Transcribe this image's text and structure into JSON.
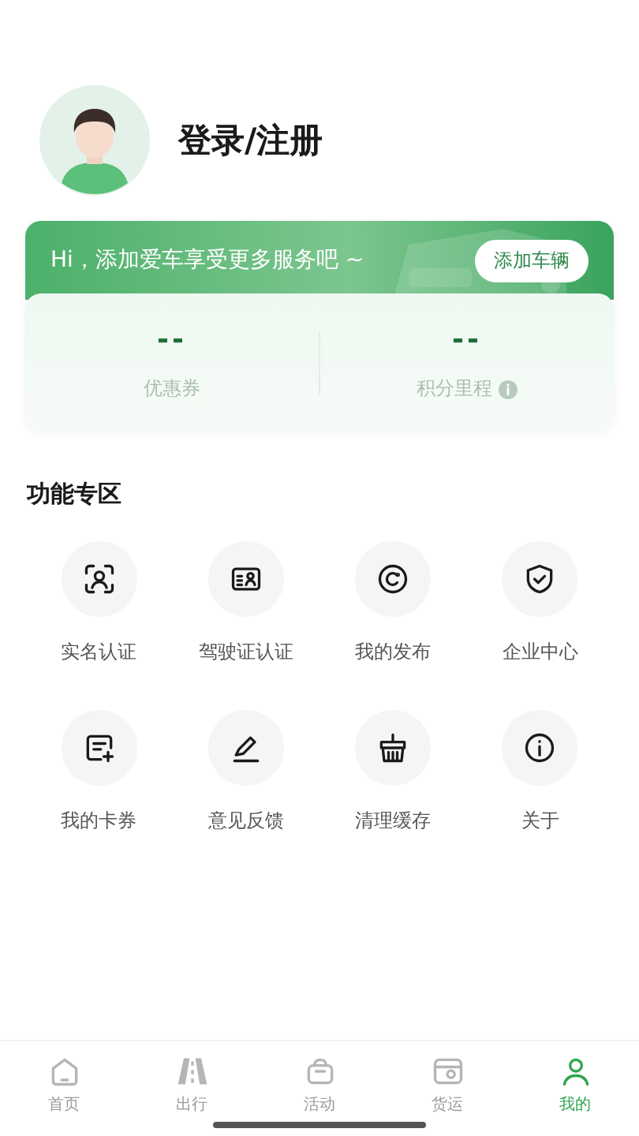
{
  "profile": {
    "login_label": "登录/注册"
  },
  "vehicle_card": {
    "greeting": "Hi，添加爱车享受更多服务吧 ~",
    "add_button": "添加车辆",
    "stats": [
      {
        "value": "--",
        "label": "优惠券",
        "info": false
      },
      {
        "value": "--",
        "label": "积分里程",
        "info": true
      }
    ]
  },
  "features": {
    "title": "功能专区",
    "items": [
      {
        "kind": "face",
        "label": "实名认证"
      },
      {
        "kind": "license",
        "label": "驾驶证认证"
      },
      {
        "kind": "publish",
        "label": "我的发布"
      },
      {
        "kind": "shield",
        "label": "企业中心"
      },
      {
        "kind": "coupon",
        "label": "我的卡券"
      },
      {
        "kind": "pen",
        "label": "意见反馈"
      },
      {
        "kind": "broom",
        "label": "清理缓存"
      },
      {
        "kind": "info",
        "label": "关于"
      }
    ]
  },
  "tab_bar": [
    {
      "kind": "home",
      "label": "首页",
      "selected": false
    },
    {
      "kind": "road",
      "label": "出行",
      "selected": false
    },
    {
      "kind": "gift",
      "label": "活动",
      "selected": false
    },
    {
      "kind": "truck",
      "label": "货运",
      "selected": false
    },
    {
      "kind": "user",
      "label": "我的",
      "selected": true
    }
  ]
}
